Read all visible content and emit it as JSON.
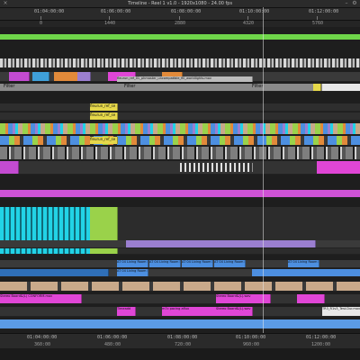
{
  "window": {
    "title": "Timeline - Reel 1 v1.0 - 1920x1080 - 24.00 fps"
  },
  "top_ruler": {
    "timecodes": [
      "01:04:00:00",
      "01:06:00:00",
      "01:08:00:00",
      "01:10:00:00",
      "01:12:00:00"
    ],
    "frames": [
      "0",
      "1440",
      "2880",
      "4320",
      "5760"
    ]
  },
  "bottom_ruler": {
    "timecodes": [
      "01:04:00:00",
      "01:06:00:00",
      "01:08:00:00",
      "01:10:00:00",
      "01:12:00:00"
    ],
    "frames": [
      "360:00",
      "480:00",
      "720:00",
      "960:00",
      "1200:00"
    ]
  },
  "labels": {
    "filter_1": "Filter",
    "filter_2": "Filter",
    "filter_3": "Filter",
    "fx_clip": "fleurun_ref_01_phmaster_uncompatible_fill_worldlights.mov",
    "ref_a": "fleurun_ref_se",
    "ref_b": "fleurun_ref_se",
    "ref_c": "fleurun_ref_se",
    "gfx_1": "AT 04 Living Room Interior",
    "gfx_2": "AT 04 Living Room Interior",
    "gfx_3": "AT 04 Living Room Interior",
    "gfx_4": "AT 04 Living Room Interior",
    "gfx_5": "AT 04 Living Room Interior",
    "gfx_6": "AT 04 Living Room Interior",
    "stereo_1": "Stereo Board&(L) CONFORM.mov",
    "stereo_2": "Stereo Board&(L).wav",
    "stereo_3": "Stereo Board&(L).wav",
    "pacing": "m7c pacing aflux",
    "pad": "Timeadd",
    "end": "TR3_R1v3_Test.Dur.mov"
  },
  "colors": {
    "green": "#6fd64a",
    "magenta": "#e046d6",
    "cyan": "#22d3e6",
    "blue": "#4d8fe0",
    "orange": "#e28a3a",
    "purple": "#9b7fd0",
    "tan": "#c9a98a",
    "lime": "#9ad24a",
    "yellow": "#e6d84a"
  }
}
